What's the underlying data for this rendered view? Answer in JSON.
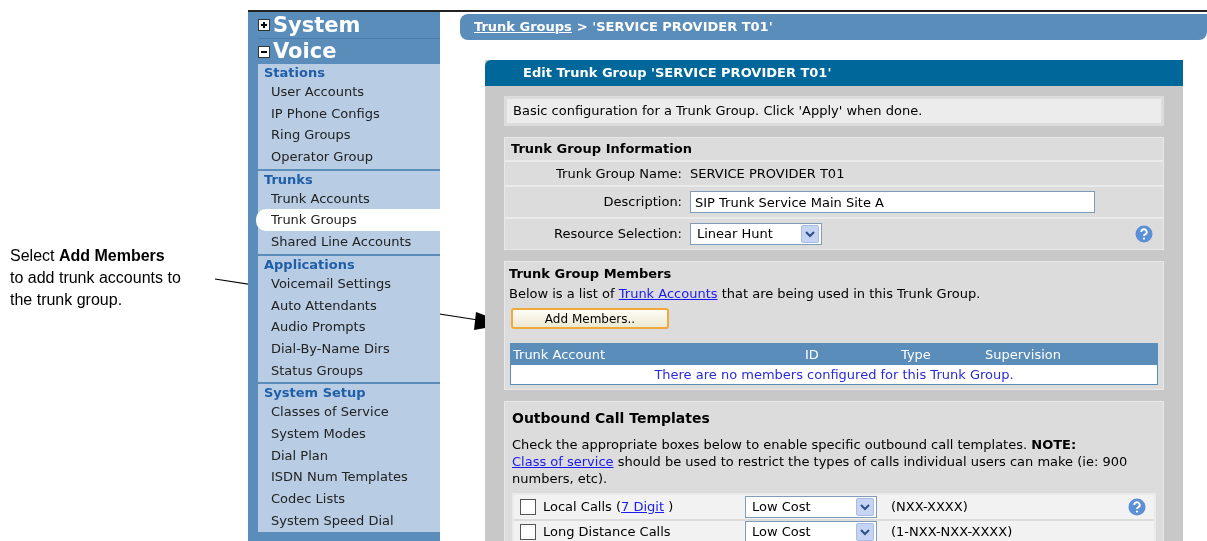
{
  "annotation": {
    "text": "Select **Add Members** to add trunk accounts to the trunk group."
  },
  "sidebar": {
    "top_sections": [
      {
        "label": "System",
        "expanded": false
      },
      {
        "label": "Voice",
        "expanded": true
      }
    ],
    "groups": [
      {
        "heading": "Stations",
        "items": [
          {
            "label": "User Accounts",
            "selected": false
          },
          {
            "label": "IP Phone Configs",
            "selected": false
          },
          {
            "label": "Ring Groups",
            "selected": false
          },
          {
            "label": "Operator Group",
            "selected": false
          }
        ]
      },
      {
        "heading": "Trunks",
        "items": [
          {
            "label": "Trunk Accounts",
            "selected": false
          },
          {
            "label": "Trunk Groups",
            "selected": true
          },
          {
            "label": "Shared Line Accounts",
            "selected": false
          }
        ]
      },
      {
        "heading": "Applications",
        "items": [
          {
            "label": "Voicemail Settings",
            "selected": false
          },
          {
            "label": "Auto Attendants",
            "selected": false
          },
          {
            "label": "Audio Prompts",
            "selected": false
          },
          {
            "label": "Dial-By-Name Dirs",
            "selected": false
          },
          {
            "label": "Status Groups",
            "selected": false
          }
        ]
      },
      {
        "heading": "System Setup",
        "items": [
          {
            "label": "Classes of Service",
            "selected": false
          },
          {
            "label": "System Modes",
            "selected": false
          },
          {
            "label": "Dial Plan",
            "selected": false
          },
          {
            "label": "ISDN Num Templates",
            "selected": false
          },
          {
            "label": "Codec Lists",
            "selected": false
          },
          {
            "label": "System Speed Dial",
            "selected": false
          }
        ]
      }
    ]
  },
  "breadcrumb": {
    "link": "Trunk Groups",
    "rest": "> 'SERVICE PROVIDER T01'"
  },
  "panel": {
    "title": "Edit Trunk Group 'SERVICE PROVIDER T01'",
    "intro": "Basic configuration for a Trunk Group. Click 'Apply' when done.",
    "info": {
      "title": "Trunk Group Information",
      "fields": [
        {
          "kind": "text",
          "label": "Trunk Group Name:",
          "value": "SERVICE PROVIDER T01",
          "help": false
        },
        {
          "kind": "input",
          "label": "Description:",
          "value": "SIP Trunk Service Main Site A",
          "help": false
        },
        {
          "kind": "select",
          "label": "Resource Selection:",
          "value": "Linear Hunt",
          "help": true
        }
      ]
    },
    "members": {
      "title": "Trunk Group Members",
      "text_before": "Below is a list of",
      "link": "Trunk Accounts",
      "text_after": "that are being used in this Trunk Group.",
      "button": "Add Members..",
      "columns": [
        "Trunk Account",
        "ID",
        "Type",
        "Supervision"
      ],
      "empty_message": "There are no members configured for this Trunk Group."
    },
    "outbound": {
      "title": "Outbound Call Templates",
      "note_before": "Check the appropriate boxes below to enable specific outbound call templates. **NOTE:**",
      "link": "Class of service",
      "note_after": "should be used to restrict the types of calls individual users can make (ie: 900 numbers, etc).",
      "rows": [
        {
          "checked": false,
          "label": "Local Calls (",
          "link": "7 Digit",
          "label_after": " )",
          "select": "Low Cost",
          "pattern": "(NXX-XXXX)",
          "help": true
        },
        {
          "checked": false,
          "label": "Long Distance Calls",
          "select": "Low Cost",
          "pattern": "(1-NXX-NXX-XXXX)",
          "help": false
        }
      ]
    }
  }
}
